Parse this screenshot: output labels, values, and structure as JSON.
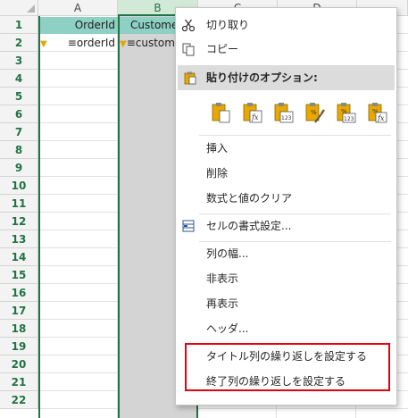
{
  "columns": [
    "A",
    "B",
    "C",
    "D"
  ],
  "rows": [
    "1",
    "2",
    "3",
    "4",
    "5",
    "6",
    "7",
    "8",
    "9",
    "10",
    "11",
    "12",
    "13",
    "14",
    "15",
    "16",
    "17",
    "18",
    "19",
    "20",
    "21",
    "22"
  ],
  "cells": {
    "a1": "OrderId",
    "b1": "Customer",
    "a2": "≡orderId",
    "b2": "≡customer"
  },
  "menu": {
    "cut": "切り取り",
    "copy": "コピー",
    "paste_options": "貼り付けのオプション:",
    "insert": "挿入",
    "delete": "削除",
    "clear_contents": "数式と値のクリア",
    "format_cells": "セルの書式設定...",
    "column_width": "列の幅...",
    "hide": "非表示",
    "unhide": "再表示",
    "header": "ヘッダ...",
    "repeat_title_columns": "タイトル列の繰り返しを設定する",
    "repeat_end_columns": "終了列の繰り返しを設定する"
  },
  "paste_icons": [
    "paste-icon",
    "paste-formulas-icon",
    "paste-values-icon",
    "paste-formatting-icon",
    "paste-values-percent-icon",
    "paste-formulas-percent-icon"
  ],
  "colors": {
    "accent": "#217346",
    "header_fill": "#8fd0c4",
    "highlight_box": "#e3000f",
    "selected_column": "#d4d4d4"
  }
}
